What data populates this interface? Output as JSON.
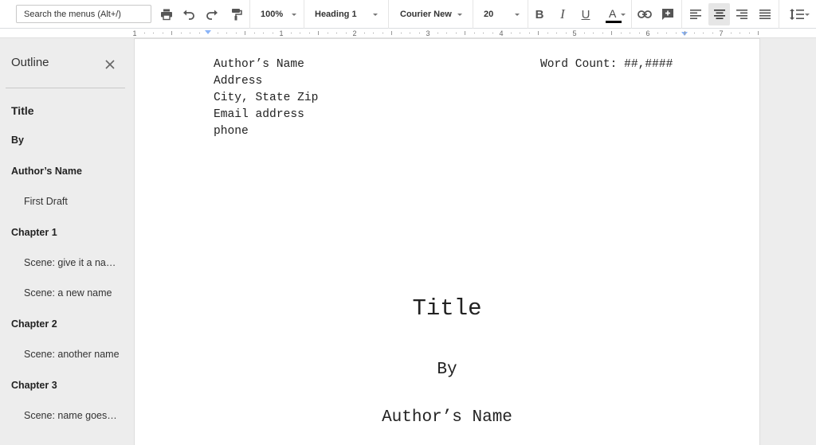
{
  "toolbar": {
    "search_placeholder": "Search the menus (Alt+/)",
    "zoom": "100%",
    "style": "Heading 1",
    "font": "Courier New",
    "font_size": "20",
    "bold_label": "B",
    "italic_label": "I",
    "underline_label": "U",
    "text_color_label": "A",
    "text_color": "#000000"
  },
  "ruler": {
    "numbers": [
      "1",
      "1",
      "2",
      "3",
      "4",
      "5",
      "6",
      "7"
    ]
  },
  "outline": {
    "title": "Outline",
    "items": [
      {
        "label": "Title",
        "level": "title"
      },
      {
        "label": "By",
        "level": "h1"
      },
      {
        "label": "Author’s Name",
        "level": "h1"
      },
      {
        "label": "First Draft",
        "level": "h2"
      },
      {
        "label": "Chapter 1",
        "level": "h1"
      },
      {
        "label": "Scene: give it a na…",
        "level": "h2"
      },
      {
        "label": "Scene: a new name",
        "level": "h2"
      },
      {
        "label": "Chapter 2",
        "level": "h1"
      },
      {
        "label": "Scene: another name",
        "level": "h2"
      },
      {
        "label": "Chapter 3",
        "level": "h1"
      },
      {
        "label": "Scene: name goes…",
        "level": "h2"
      }
    ]
  },
  "document": {
    "address_lines": [
      "Author’s Name",
      "Address",
      "City, State Zip",
      "Email address",
      "phone"
    ],
    "word_count": "Word Count: ##,####",
    "title": "Title",
    "by": "By",
    "author": "Author’s Name"
  }
}
